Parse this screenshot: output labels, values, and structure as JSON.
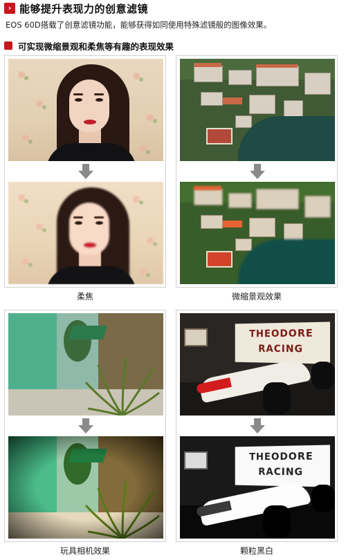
{
  "header": {
    "title": "能够提升表现力的创意滤镜",
    "chevron": "›"
  },
  "intro": "EOS 60D搭载了创意滤镜功能，能够获得如同使用特殊滤镜般的图像效果。",
  "section": {
    "heading": "可实现微缩景观和柔焦等有趣的表现效果"
  },
  "cards": [
    {
      "caption": "柔焦"
    },
    {
      "caption": "微缩景观效果"
    },
    {
      "caption": "玩具相机效果"
    },
    {
      "caption": "颗粒黑白"
    }
  ],
  "banner": {
    "line1": "THEODORE",
    "line2": "RACING"
  },
  "icons": {
    "down_arrow": "down-arrow-icon",
    "chevron": "chevron-right-icon",
    "bullet": "red-square-bullet"
  },
  "colors": {
    "accent": "#c8161d",
    "arrow": "#8a8a8a",
    "border": "#cfcfcf"
  }
}
